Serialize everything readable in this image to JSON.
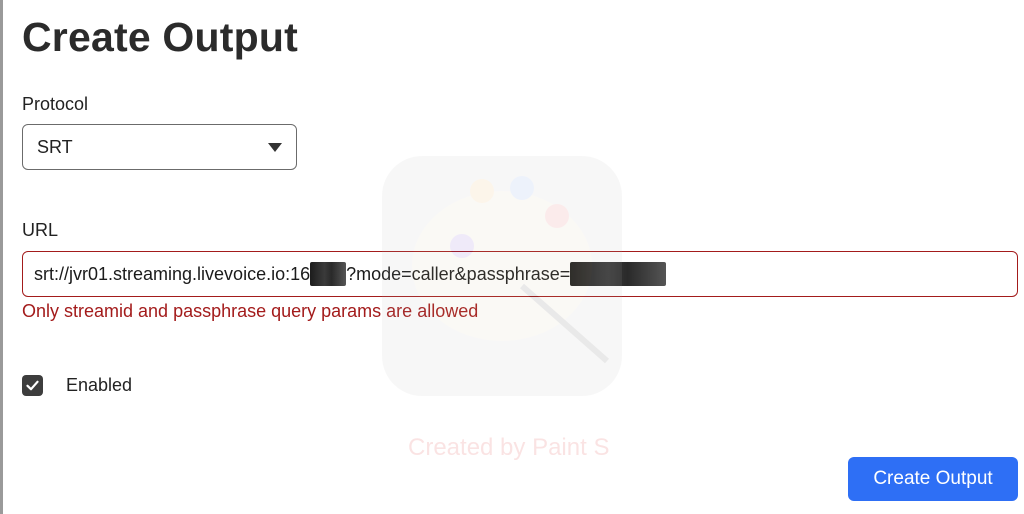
{
  "page": {
    "title": "Create Output"
  },
  "protocol": {
    "label": "Protocol",
    "selected": "SRT"
  },
  "url": {
    "label": "URL",
    "value_part1": "srt://jvr01.streaming.livevoice.io:16",
    "value_part2": "?mode=caller&passphrase=",
    "error": "Only streamid and passphrase query params are allowed",
    "error_color": "#a31b1b"
  },
  "enabled": {
    "label": "Enabled",
    "checked": true
  },
  "watermark": {
    "text": "Created by Paint S"
  },
  "actions": {
    "submit_label": "Create Output",
    "submit_color": "#2e6ff5"
  }
}
